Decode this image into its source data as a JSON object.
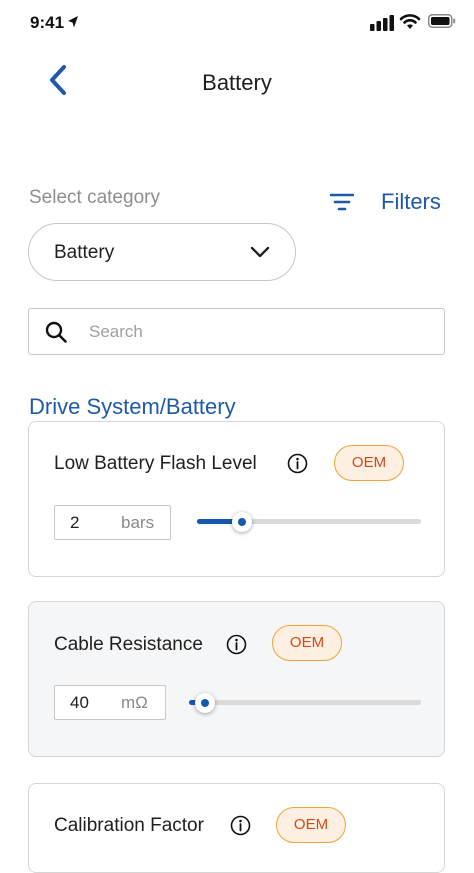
{
  "status_bar": {
    "time": "9:41"
  },
  "header": {
    "title": "Battery"
  },
  "category": {
    "label": "Select category",
    "selected": "Battery",
    "filters_label": "Filters"
  },
  "search": {
    "placeholder": "Search",
    "value": ""
  },
  "section": {
    "title": "Drive System/Battery"
  },
  "settings": [
    {
      "title": "Low Battery Flash Level",
      "badge": "OEM",
      "value": "2",
      "unit": "bars",
      "slider_fraction": 0.2
    },
    {
      "title": "Cable Resistance",
      "badge": "OEM",
      "value": "40",
      "unit": "mΩ",
      "slider_fraction": 0.07
    },
    {
      "title": "Calibration Factor",
      "badge": "OEM"
    }
  ],
  "colors": {
    "accent": "#1f5aa6",
    "slider_fill": "#1558b0",
    "badge_border": "#f0a33a",
    "badge_text": "#cf4a1a",
    "badge_bg": "#fdf0e2"
  }
}
